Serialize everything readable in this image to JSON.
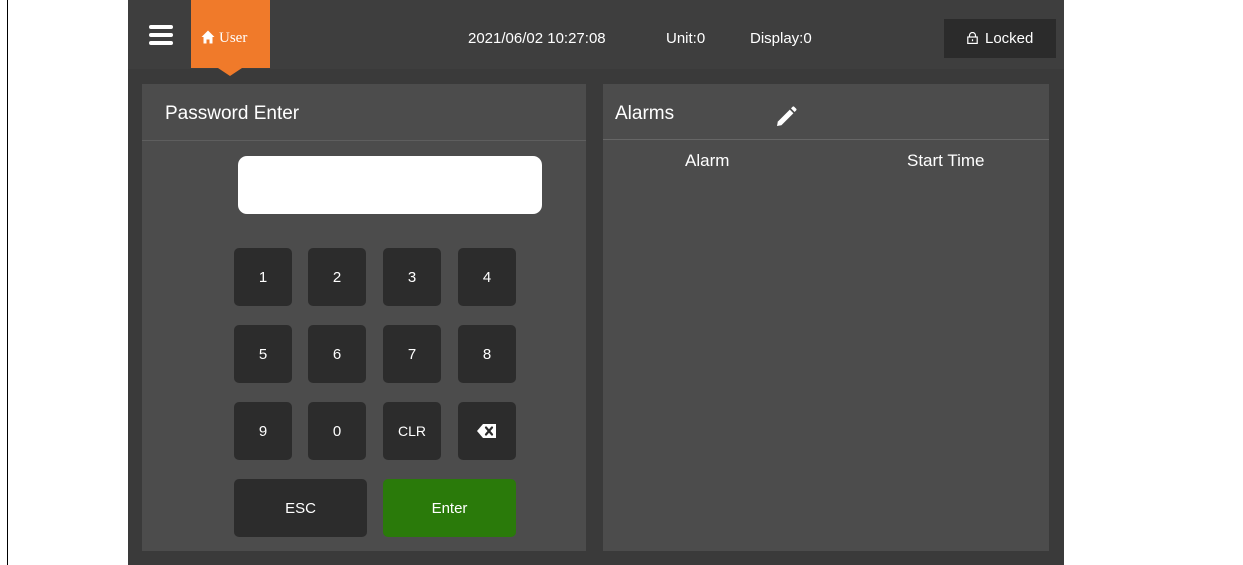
{
  "topbar": {
    "user_tab_label": "User",
    "datetime": "2021/06/02 10:27:08",
    "unit": "Unit:0",
    "display": "Display:0",
    "lock_label": "Locked"
  },
  "password_panel": {
    "title": "Password Enter",
    "input_value": "",
    "keys": {
      "k1": "1",
      "k2": "2",
      "k3": "3",
      "k4": "4",
      "k5": "5",
      "k6": "6",
      "k7": "7",
      "k8": "8",
      "k9": "9",
      "k0": "0",
      "clr": "CLR",
      "esc": "ESC",
      "enter": "Enter"
    }
  },
  "alarms_panel": {
    "title": "Alarms",
    "columns": [
      "Alarm",
      "Start Time"
    ],
    "rows": []
  },
  "colors": {
    "accent_orange": "#f07a2a",
    "enter_green": "#2a7a0a",
    "panel_bg": "#4c4c4c",
    "key_bg": "#2c2c2c"
  },
  "icons": {
    "menu": "hamburger-menu-icon",
    "home": "home-icon",
    "lock": "lock-icon",
    "backspace": "backspace-icon",
    "edit": "pencil-edit-icon"
  }
}
